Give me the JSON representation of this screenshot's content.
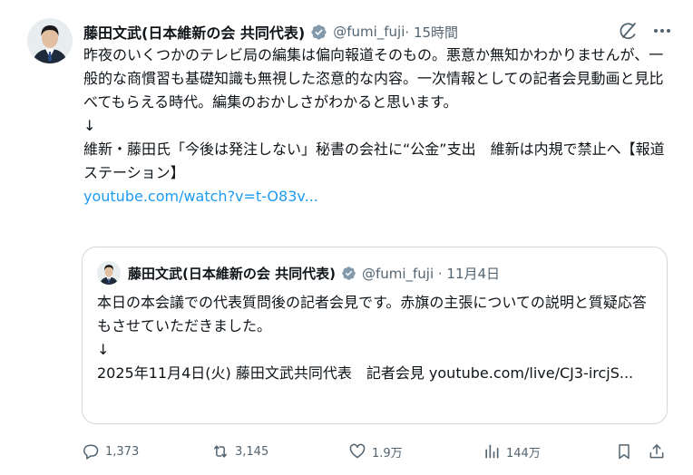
{
  "author": {
    "name": "藤田文武(日本維新の会 共同代表)",
    "handle": "@fumi_fuji",
    "time": "· 15時間",
    "avatar_icon": "avatar-photo"
  },
  "post": {
    "paragraphs": [
      "昨夜のいくつかのテレビ局の編集は偏向報道そのもの。悪意か無知かわかりませんが、一般的な商慣習も基礎知識も無視した恣意的な内容。一次情報としての記者会見動画と見比べてもらえる時代。編集のおかしさがわかると思います。",
      "↓",
      "維新・藤田氏「今後は発注しない」秘書の会社に“公金”支出　維新は内規で禁止へ【報道ステーション】"
    ],
    "link": "youtube.com/watch?v=t-O83v..."
  },
  "quote": {
    "name": "藤田文武(日本維新の会 共同代表)",
    "handle": "@fumi_fuji · 11月4日",
    "paragraphs": [
      "本日の本会議での代表質問後の記者会見です。赤旗の主張についての説明と質疑応答もさせていただきました。",
      "↓",
      "2025年11月4日(火)  藤田文武共同代表　記者会見 youtube.com/live/CJ3-ircjS..."
    ]
  },
  "actions": {
    "replies": "1,373",
    "reposts": "3,145",
    "likes": "1.9万",
    "views": "144万"
  },
  "colors": {
    "link": "#1d9bf0",
    "secondary_text": "#536471",
    "verified": "#829aab",
    "border": "#cfd9de"
  }
}
